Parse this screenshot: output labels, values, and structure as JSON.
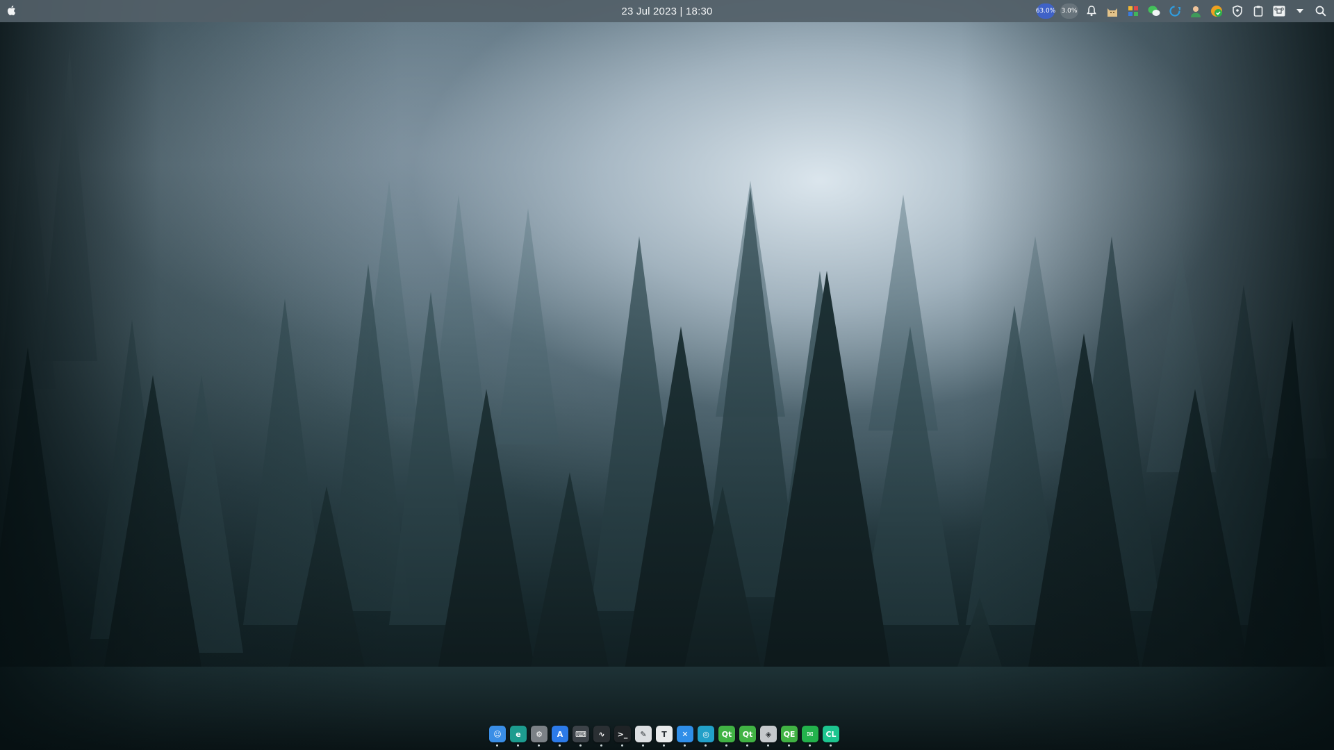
{
  "menubar": {
    "datetime": "23 Jul 2023 | 18:30",
    "cpu_usage": "63.0%",
    "memory_usage": "3.0%",
    "status_icons": [
      "bell-icon",
      "cat-icon",
      "color-app-icon",
      "wechat-icon",
      "refresh-icon",
      "person-icon",
      "check-icon",
      "shield-icon",
      "clipboard-icon",
      "command-icon",
      "chevron-down-icon",
      "search-icon"
    ]
  },
  "dock": {
    "apps": [
      {
        "icon": "finder-icon",
        "glyph": "☺",
        "color": "#3a8ee6"
      },
      {
        "icon": "edge-browser-icon",
        "glyph": "e",
        "color": "#1d9c8f"
      },
      {
        "icon": "settings-icon",
        "glyph": "⚙",
        "color": "#7b8186"
      },
      {
        "icon": "app-store-icon",
        "glyph": "A",
        "color": "#2c7ae8"
      },
      {
        "icon": "keyboard-icon",
        "glyph": "⌨",
        "color": "#3c4248"
      },
      {
        "icon": "activity-monitor-icon",
        "glyph": "∿",
        "color": "#2a2f33"
      },
      {
        "icon": "terminal-icon",
        "glyph": ">_",
        "color": "#1f2326"
      },
      {
        "icon": "text-editor-icon",
        "glyph": "✎",
        "color": "#dcdfe2"
      },
      {
        "icon": "typora-icon",
        "glyph": "T",
        "color": "#e9ebec"
      },
      {
        "icon": "xcode-icon",
        "glyph": "✕",
        "color": "#2f8ee8"
      },
      {
        "icon": "search-app-icon",
        "glyph": "◎",
        "color": "#22a0c8"
      },
      {
        "icon": "qt-creator-icon",
        "glyph": "Qt",
        "color": "#41b344"
      },
      {
        "icon": "qt-designer-icon",
        "glyph": "Qt",
        "color": "#41b344"
      },
      {
        "icon": "unity-icon",
        "glyph": "◈",
        "color": "#c5c9cc"
      },
      {
        "icon": "qt-linguist-icon",
        "glyph": "QE",
        "color": "#41b344"
      },
      {
        "icon": "wechat-app-icon",
        "glyph": "✉",
        "color": "#23b24c"
      },
      {
        "icon": "clion-icon",
        "glyph": "CL",
        "color": "#1dc58f"
      }
    ]
  }
}
